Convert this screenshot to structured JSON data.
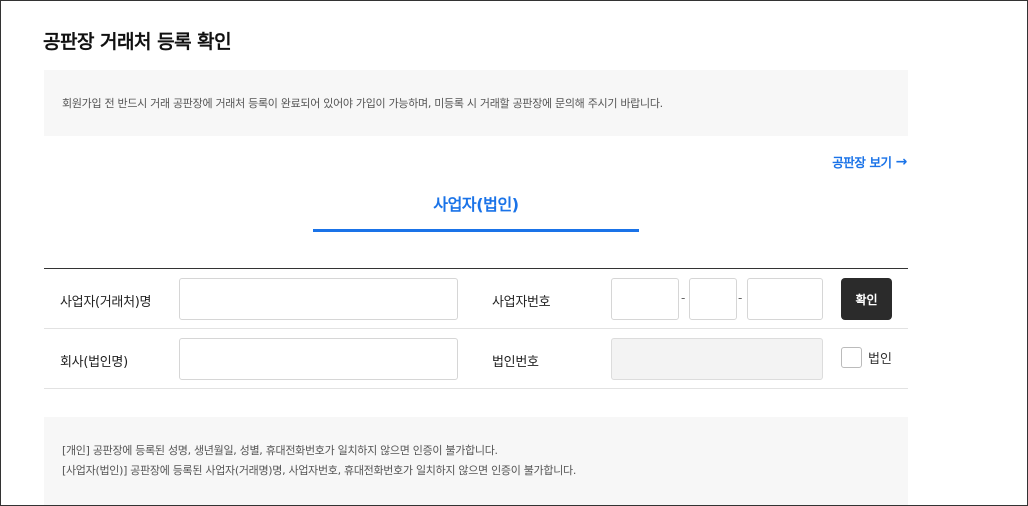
{
  "page": {
    "title": "공판장 거래처 등록 확인"
  },
  "notice": {
    "text": "회원가입 전 반드시 거래 공판장에 거래처 등록이 완료되어 있어야 가입이 가능하며, 미등록 시 거래할 공판장에 문의해 주시기 바랍니다."
  },
  "view_link": {
    "label": "공판장 보기",
    "icon": "→"
  },
  "tab": {
    "label": "사업자(법인)"
  },
  "form": {
    "business_name_label": "사업자(거래처)명",
    "business_name_value": "",
    "business_no_label": "사업자번호",
    "business_no_parts": [
      "",
      "",
      ""
    ],
    "separator": "-",
    "confirm_label": "확인",
    "company_label": "회사(법인명)",
    "company_value": "",
    "corp_no_label": "법인번호",
    "corp_no_value": "",
    "corp_checkbox_label": "법인"
  },
  "info": {
    "line1": "[개인] 공판장에 등록된 성명, 생년월일, 성별, 휴대전화번호가 일치하지 않으면 인증이 불가합니다.",
    "line2": "[사업자(법인)] 공판장에 등록된 사업자(거래명)명, 사업자번호, 휴대전화번호가 일치하지 않으면 인증이 불가합니다."
  },
  "colors": {
    "accent": "#1a73e8",
    "button_dark": "#2b2b2b",
    "box_bg": "#f7f7f7"
  }
}
